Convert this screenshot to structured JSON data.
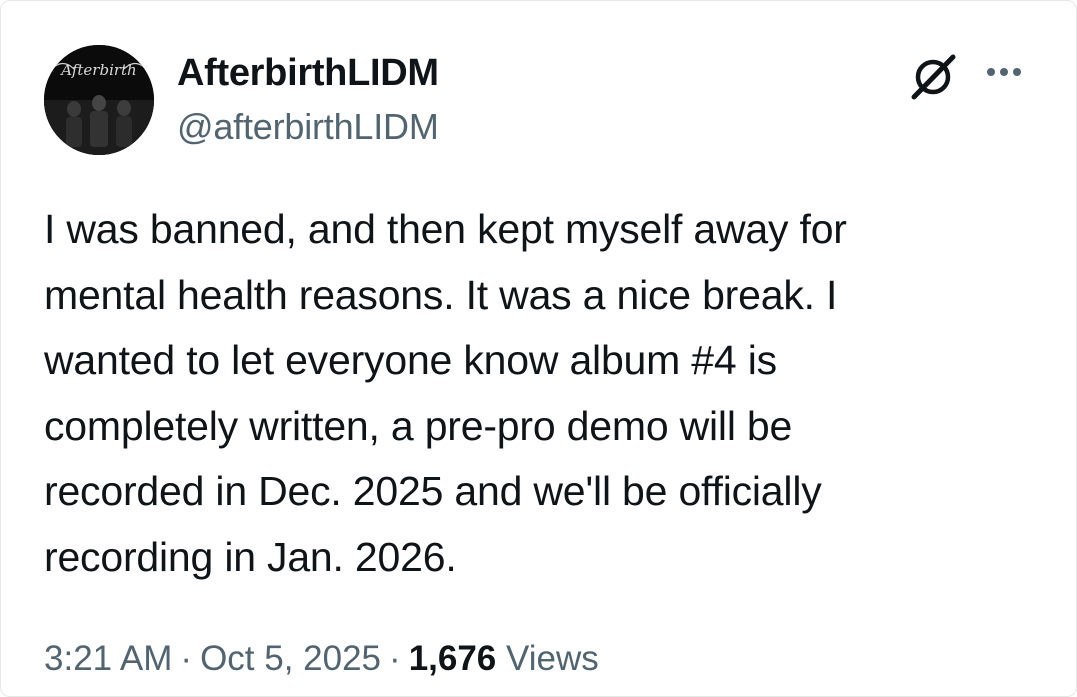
{
  "author": {
    "display_name": "AfterbirthLIDM",
    "handle": "@afterbirthLIDM",
    "avatar_logo_text": "Afterbirth"
  },
  "actions": {
    "grok_icon": "grok-icon",
    "more_icon": "more-options-icon"
  },
  "tweet": {
    "text": "I was banned, and then kept myself away for\nmental health reasons. It was a nice break. I\nwanted to let everyone know album #4 is\ncompletely written, a pre-pro demo will be\nrecorded in Dec. 2025 and we'll be officially\nrecording in Jan. 2026.",
    "time": "3:21 AM",
    "separator": "·",
    "date": "Oct 5, 2025",
    "views_count": "1,676",
    "views_label": "Views"
  },
  "colors": {
    "text_primary": "#0f1419",
    "text_secondary": "#536471",
    "background": "#ffffff"
  }
}
